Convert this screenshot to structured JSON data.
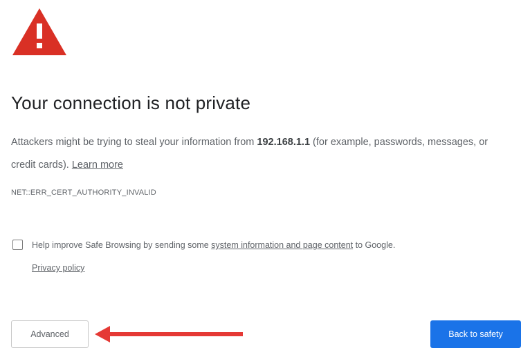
{
  "icons": {
    "warning": "warning-triangle-icon",
    "arrow": "red-arrow-left-icon"
  },
  "colors": {
    "warning_red": "#d93025",
    "primary_blue": "#1a73e8",
    "arrow_red": "#e53935",
    "title_text": "#202124",
    "body_text": "#5f6368"
  },
  "heading": {
    "title": "Your connection is not private"
  },
  "description": {
    "before_host": "Attackers might be trying to steal your information from ",
    "host": "192.168.1.1",
    "after_host": " (for example, passwords, messages, or credit cards). ",
    "learn_more": "Learn more"
  },
  "error_code": "NET::ERR_CERT_AUTHORITY_INVALID",
  "safe_browsing": {
    "checked": false,
    "text_before": "Help improve Safe Browsing by sending some ",
    "link_system_info": "system information and page content",
    "text_after": " to Google.",
    "privacy_link": "Privacy policy"
  },
  "buttons": {
    "advanced": "Advanced",
    "back_to_safety": "Back to safety"
  }
}
